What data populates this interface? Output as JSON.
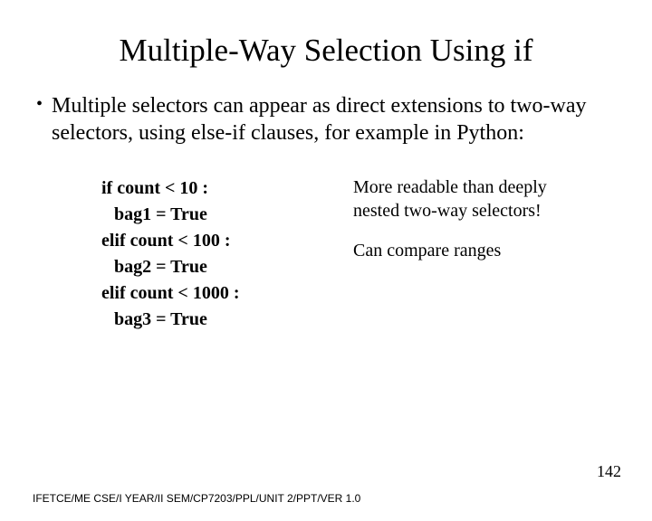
{
  "title": "Multiple-Way Selection Using if",
  "bullet": "Multiple selectors can appear as direct extensions to two-way selectors, using else-if clauses, for example in Python:",
  "code": {
    "l1": "if count < 10 :",
    "l2": "bag1 = True",
    "l3": "elif count < 100 :",
    "l4": "bag2 = True",
    "l5": "elif count < 1000 :",
    "l6": "bag3 = True"
  },
  "notes": {
    "n1a": "More readable than deeply",
    "n1b": "nested two-way selectors!",
    "n2": "Can compare ranges"
  },
  "footer": "IFETCE/ME CSE/I YEAR/II SEM/CP7203/PPL/UNIT 2/PPT/VER 1.0",
  "pagenum": "142"
}
